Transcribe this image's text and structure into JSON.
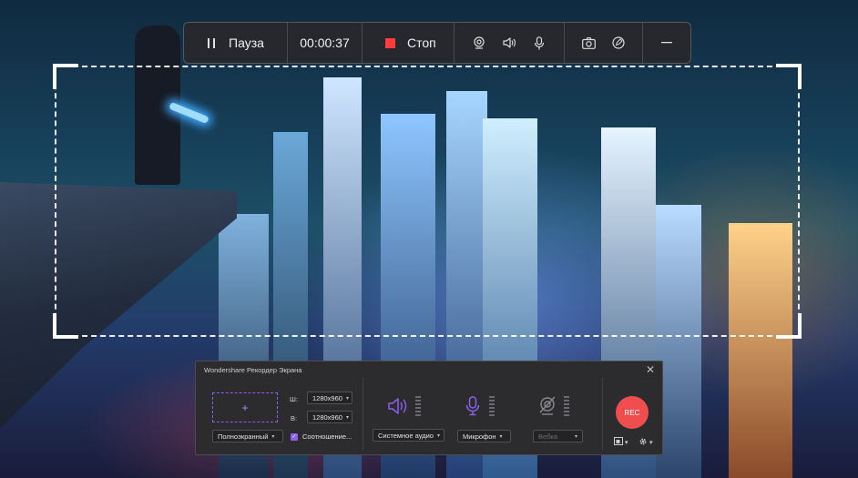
{
  "toolbar": {
    "pause_label": "Пауза",
    "timer": "00:00:37",
    "stop_label": "Стоп",
    "stop_color": "#ff3b3b"
  },
  "panel": {
    "title": "Wondershare Рекордер Экрана",
    "area_plus": "+",
    "mode_value": "Полноэкранный",
    "width_label": "Ш:",
    "height_label": "В:",
    "width_value": "1280x960",
    "height_value": "1280x960",
    "aspect_label": "Соотношение...",
    "system_audio": "Системное аудио",
    "microphone": "Микрофон",
    "webcam": "Вебка",
    "rec_label": "REC",
    "accent_color": "#8c5ff0",
    "rec_color": "#f04e4e"
  }
}
